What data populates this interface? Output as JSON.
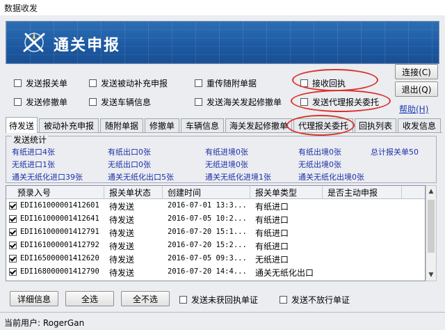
{
  "window": {
    "title": "数据收发"
  },
  "banner": {
    "title": "通关申报"
  },
  "send_options": [
    {
      "label": "发送报关单",
      "checked": false
    },
    {
      "label": "发送被动补充申报",
      "checked": false
    },
    {
      "label": "重传随附单据",
      "checked": false
    },
    {
      "label": "接收回执",
      "checked": false
    },
    {
      "label": "发送修撤单",
      "checked": false
    },
    {
      "label": "发送车辆信息",
      "checked": false
    },
    {
      "label": "发送海关发起修撤单",
      "checked": false
    },
    {
      "label": "发送代理报关委托",
      "checked": false
    }
  ],
  "actions": {
    "connect": "连接(C)",
    "exit": "退出(Q)",
    "help": "帮助(H)"
  },
  "tabs": [
    "待发送",
    "被动补充申报",
    "随附单据",
    "修撤单",
    "车辆信息",
    "海关发起修撤单",
    "代理报关委托",
    "回执列表",
    "收发信息"
  ],
  "stats": {
    "legend": "发送统计",
    "items": [
      "有纸进口4张",
      "有纸出口0张",
      "有纸进境0张",
      "有纸出境0张",
      "总计报关单50",
      "无纸进口1张",
      "无纸出口0张",
      "无纸进境0张",
      "无纸出境0张",
      "通关无纸化进口39张",
      "通关无纸化出口5张",
      "通关无纸化进境1张",
      "通关无纸化出境0张"
    ]
  },
  "table": {
    "headers": [
      "预录入号",
      "报关单状态",
      "创建时间",
      "报关单类型",
      "是否主动申报"
    ],
    "rows": [
      {
        "id": "EDI161000001412601",
        "status": "待发送",
        "created": "2016-07-01 13:3...",
        "type": "有纸进口",
        "checked": true
      },
      {
        "id": "EDI161000001412641",
        "status": "待发送",
        "created": "2016-07-05 10:2...",
        "type": "有纸进口",
        "checked": true
      },
      {
        "id": "EDI161000001412791",
        "status": "待发送",
        "created": "2016-07-20 15:1...",
        "type": "有纸进口",
        "checked": true
      },
      {
        "id": "EDI161000001412792",
        "status": "待发送",
        "created": "2016-07-20 15:2...",
        "type": "有纸进口",
        "checked": true
      },
      {
        "id": "EDI165000001412620",
        "status": "待发送",
        "created": "2016-07-05 09:3...",
        "type": "无纸进口",
        "checked": true
      },
      {
        "id": "EDI168000001412790",
        "status": "待发送",
        "created": "2016-07-20 14:4...",
        "type": "通关无纸化出口",
        "checked": true
      }
    ]
  },
  "bottom": {
    "details": "详细信息",
    "select_all": "全选",
    "select_none": "全不选",
    "send_no_receipt": "发送未获回执单证",
    "send_not_released": "发送不放行单证"
  },
  "status": {
    "current_user": "当前用户: RogerGan"
  },
  "highlight_color": "#d9342d"
}
